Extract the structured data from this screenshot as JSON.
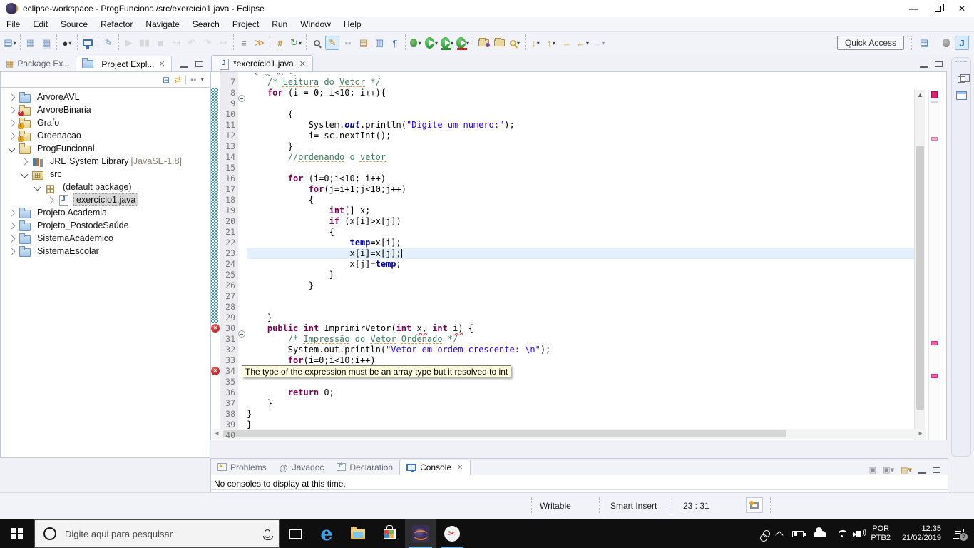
{
  "window": {
    "title": "eclipse-workspace - ProgFuncional/src/exercício1.java - Eclipse",
    "menus": [
      "File",
      "Edit",
      "Source",
      "Refactor",
      "Navigate",
      "Search",
      "Project",
      "Run",
      "Window",
      "Help"
    ]
  },
  "toolbar": {
    "quick_access": "Quick Access",
    "groups": [
      [
        {
          "n": "new-wizard",
          "g": "▤",
          "col": "#4a7ab8",
          "dd": 1
        }
      ],
      [
        {
          "n": "save",
          "g": "▦",
          "col": "#8099bd"
        },
        {
          "n": "save-all",
          "g": "▦",
          "col": "#8099bd",
          "dbl": 1
        }
      ],
      [
        {
          "n": "user-account",
          "g": "●",
          "col": "#2e2e2e",
          "dd": 1
        }
      ],
      [
        {
          "n": "open-console",
          "t": "mon"
        }
      ],
      [
        {
          "n": "block-selection",
          "g": "✎",
          "col": "#7d9bc0"
        }
      ],
      [
        {
          "n": "resume",
          "g": "▶",
          "col": "#c3c3c3",
          "dis": 1
        },
        {
          "n": "suspend",
          "g": "▮▮",
          "col": "#c3c3c3",
          "dis": 1
        },
        {
          "n": "terminate",
          "g": "■",
          "col": "#c3c3c3",
          "dis": 1
        },
        {
          "n": "step-filters",
          "g": "↝",
          "col": "#c3c3c3",
          "dis": 1
        },
        {
          "n": "step-into",
          "g": "↶",
          "col": "#c3c3c3",
          "dis": 1
        },
        {
          "n": "step-over",
          "g": "↷",
          "col": "#c3c3c3",
          "dis": 1
        },
        {
          "n": "step-return",
          "g": "↪",
          "col": "#c3c3c3",
          "dis": 1
        }
      ],
      [
        {
          "n": "skip-all-breakpoints",
          "g": "≡",
          "col": "#8a8a8a"
        },
        {
          "n": "filter",
          "g": "≫",
          "col": "#d08a2a"
        }
      ],
      [
        {
          "n": "new-java-package",
          "g": "#",
          "col": "#c98a2e",
          "bold": 1
        },
        {
          "n": "build-all",
          "g": "↻",
          "col": "#3f9b44",
          "dd": 1
        }
      ],
      [
        {
          "n": "plug-search",
          "t": "mag"
        },
        {
          "n": "mark-occurrences",
          "g": "✎",
          "col": "#c9a23a",
          "act": 1
        },
        {
          "n": "inactive-dots",
          "g": "••",
          "col": "#b0b0b0"
        },
        {
          "n": "open-task",
          "g": "▤",
          "col": "#b58a3a"
        },
        {
          "n": "show-source",
          "g": "▥",
          "col": "#4a7ab8"
        },
        {
          "n": "show-whitespace",
          "g": "¶",
          "col": "#4a7ab8"
        }
      ],
      [
        {
          "n": "debug",
          "t": "bug",
          "dd": 1
        },
        {
          "n": "run",
          "t": "run",
          "dd": 1
        },
        {
          "n": "coverage",
          "t": "runc",
          "dd": 1
        },
        {
          "n": "profile",
          "t": "runp",
          "dd": 1
        }
      ],
      [
        {
          "n": "import-project",
          "t": "foldp"
        },
        {
          "n": "open-project",
          "t": "fold"
        },
        {
          "n": "search-torch",
          "t": "magg",
          "dd": 1
        }
      ],
      [
        {
          "n": "next-annotation",
          "g": "↓",
          "col": "#caa23a",
          "dd": 1
        },
        {
          "n": "prev-annotation",
          "g": "↑",
          "col": "#caa23a",
          "dd": 1
        },
        {
          "n": "last-edit-location",
          "g": "←",
          "col": "#e0a92e"
        },
        {
          "n": "back-history",
          "g": "←",
          "col": "#e0a92e",
          "dd": 1
        },
        {
          "n": "forward-history",
          "g": "→",
          "col": "#c3c3c3",
          "dd": 1,
          "dis": 1
        }
      ]
    ],
    "perspectives": [
      {
        "n": "open-perspective",
        "g": "▤",
        "col": "#4a7ab8"
      },
      {
        "n": "perspective-debug",
        "t": "bugg"
      },
      {
        "n": "perspective-java",
        "g": "J",
        "col": "#2e5fa3",
        "act": 1,
        "bold": 1
      }
    ]
  },
  "explorer": {
    "tab_package": "Package Ex...",
    "tab_project": "Project Expl...",
    "tree": [
      {
        "lvl": 0,
        "chev": "r",
        "icon": "folder",
        "label": "ArvoreAVL"
      },
      {
        "lvl": 0,
        "chev": "r",
        "icon": "jproj",
        "badge": "err",
        "label": "ArvoreBinaria"
      },
      {
        "lvl": 0,
        "chev": "r",
        "icon": "jproj",
        "badge": "warn",
        "label": "Grafo"
      },
      {
        "lvl": 0,
        "chev": "r",
        "icon": "jproj",
        "badge": "warn",
        "label": "Ordenacao"
      },
      {
        "lvl": 0,
        "chev": "d",
        "icon": "jproj",
        "label": "ProgFuncional"
      },
      {
        "lvl": 1,
        "chev": "r",
        "icon": "jre",
        "label": "JRE System Library",
        "suffix": " [JavaSE-1.8]"
      },
      {
        "lvl": 1,
        "chev": "d",
        "icon": "src",
        "label": "src"
      },
      {
        "lvl": 2,
        "chev": "d",
        "icon": "pkg",
        "label": "(default package)"
      },
      {
        "lvl": 3,
        "chev": "r",
        "icon": "jfile",
        "label": "exercício1.java",
        "selected": true
      },
      {
        "lvl": 0,
        "chev": "r",
        "icon": "folder",
        "label": "Projeto Academia"
      },
      {
        "lvl": 0,
        "chev": "r",
        "icon": "folder",
        "label": "Projeto_PostodeSaúde"
      },
      {
        "lvl": 0,
        "chev": "r",
        "icon": "folder",
        "label": "SistemaAcademico"
      },
      {
        "lvl": 0,
        "chev": "r",
        "icon": "folder",
        "label": "SistemaEscolar"
      }
    ]
  },
  "editor": {
    "tab": "*exercício1.java",
    "tooltip": "The type of the expression must be an array type but it resolved to int",
    "range_band": {
      "from": 8,
      "to": 29
    },
    "lines": [
      {
        "n": 7,
        "seg": [
          {
            "t": "    /* ",
            "c": "c"
          },
          {
            "t": "Leitura",
            "c": "c cs"
          },
          {
            "t": " do ",
            "c": "c"
          },
          {
            "t": "Vetor",
            "c": "c cs"
          },
          {
            "t": " */",
            "c": "c"
          }
        ]
      },
      {
        "n": 8,
        "fold": true,
        "seg": [
          {
            "t": "    ",
            "c": "d"
          },
          {
            "t": "for",
            "c": "k"
          },
          {
            "t": " (i = 0; i<10; i++){",
            "c": "d"
          }
        ]
      },
      {
        "n": 9,
        "seg": []
      },
      {
        "n": 10,
        "seg": [
          {
            "t": "        {",
            "c": "d"
          }
        ]
      },
      {
        "n": 11,
        "seg": [
          {
            "t": "            System.",
            "c": "d"
          },
          {
            "t": "out",
            "c": "io"
          },
          {
            "t": ".println(",
            "c": "d"
          },
          {
            "t": "\"Digite um numero:\"",
            "c": "s"
          },
          {
            "t": ");",
            "c": "d"
          }
        ]
      },
      {
        "n": 12,
        "seg": [
          {
            "t": "            i= sc.nextInt();",
            "c": "d"
          }
        ]
      },
      {
        "n": 13,
        "seg": [
          {
            "t": "        }",
            "c": "d"
          }
        ]
      },
      {
        "n": 14,
        "seg": [
          {
            "t": "        //",
            "c": "c"
          },
          {
            "t": "ordenando",
            "c": "c cs"
          },
          {
            "t": " o ",
            "c": "c"
          },
          {
            "t": "vetor",
            "c": "c cs"
          }
        ]
      },
      {
        "n": 15,
        "seg": []
      },
      {
        "n": 16,
        "seg": [
          {
            "t": "        ",
            "c": "d"
          },
          {
            "t": "for",
            "c": "k"
          },
          {
            "t": " (i=0;i<10; i++)",
            "c": "d"
          }
        ]
      },
      {
        "n": 17,
        "seg": [
          {
            "t": "            ",
            "c": "d"
          },
          {
            "t": "for",
            "c": "k"
          },
          {
            "t": "(j=i+1;j<10;j++)",
            "c": "d"
          }
        ]
      },
      {
        "n": 18,
        "seg": [
          {
            "t": "            {",
            "c": "d"
          }
        ]
      },
      {
        "n": 19,
        "seg": [
          {
            "t": "                ",
            "c": "d"
          },
          {
            "t": "int",
            "c": "k"
          },
          {
            "t": "[] x;",
            "c": "d"
          }
        ]
      },
      {
        "n": 20,
        "seg": [
          {
            "t": "                ",
            "c": "d"
          },
          {
            "t": "if",
            "c": "k"
          },
          {
            "t": " (x[i]>x[j])",
            "c": "d"
          }
        ]
      },
      {
        "n": 21,
        "seg": [
          {
            "t": "                {",
            "c": "d"
          }
        ]
      },
      {
        "n": 22,
        "seg": [
          {
            "t": "                    ",
            "c": "d"
          },
          {
            "t": "temp",
            "c": "f"
          },
          {
            "t": "=x[i];",
            "c": "d"
          }
        ]
      },
      {
        "n": 23,
        "current": true,
        "caret": true,
        "seg": [
          {
            "t": "                    x[i]=x[j];",
            "c": "d"
          }
        ]
      },
      {
        "n": 24,
        "seg": [
          {
            "t": "                    x[j]=",
            "c": "d"
          },
          {
            "t": "temp",
            "c": "f"
          },
          {
            "t": ";",
            "c": "d"
          }
        ]
      },
      {
        "n": 25,
        "seg": [
          {
            "t": "                }",
            "c": "d"
          }
        ]
      },
      {
        "n": 26,
        "seg": [
          {
            "t": "            }",
            "c": "d"
          }
        ]
      },
      {
        "n": 27,
        "seg": []
      },
      {
        "n": 28,
        "seg": []
      },
      {
        "n": 29,
        "seg": [
          {
            "t": "    }",
            "c": "d"
          }
        ]
      },
      {
        "n": 30,
        "fold": true,
        "error": true,
        "seg": [
          {
            "t": "    ",
            "c": "d"
          },
          {
            "t": "public",
            "c": "k"
          },
          {
            "t": " ",
            "c": "d"
          },
          {
            "t": "int",
            "c": "k"
          },
          {
            "t": " ImprimirVetor(",
            "c": "d"
          },
          {
            "t": "int",
            "c": "k"
          },
          {
            "t": " ",
            "c": "d"
          },
          {
            "t": "x,",
            "c": "d es"
          },
          {
            "t": " ",
            "c": "d"
          },
          {
            "t": "int",
            "c": "k"
          },
          {
            "t": " ",
            "c": "d"
          },
          {
            "t": "i)",
            "c": "d es"
          },
          {
            "t": " {",
            "c": "d"
          }
        ]
      },
      {
        "n": 31,
        "seg": [
          {
            "t": "        /* ",
            "c": "c"
          },
          {
            "t": "Impressão",
            "c": "c cs"
          },
          {
            "t": " do ",
            "c": "c"
          },
          {
            "t": "Vetor",
            "c": "c cs"
          },
          {
            "t": " ",
            "c": "c"
          },
          {
            "t": "Ordenado",
            "c": "c cs"
          },
          {
            "t": " */",
            "c": "c"
          }
        ]
      },
      {
        "n": 32,
        "seg": [
          {
            "t": "        System.out.println(",
            "c": "d"
          },
          {
            "t": "\"Vetor em ordem crescente: \\n\"",
            "c": "s"
          },
          {
            "t": ");",
            "c": "d"
          }
        ]
      },
      {
        "n": 33,
        "seg": [
          {
            "t": "        ",
            "c": "d"
          },
          {
            "t": "for",
            "c": "k"
          },
          {
            "t": "(i=0;i<10;i++)",
            "c": "d"
          }
        ]
      },
      {
        "n": 34,
        "error": true,
        "seg": []
      },
      {
        "n": 35,
        "seg": []
      },
      {
        "n": 36,
        "seg": [
          {
            "t": "        ",
            "c": "d"
          },
          {
            "t": "return",
            "c": "k"
          },
          {
            "t": " 0;",
            "c": "d"
          }
        ]
      },
      {
        "n": 37,
        "seg": [
          {
            "t": "    }",
            "c": "d"
          }
        ]
      },
      {
        "n": 38,
        "seg": [
          {
            "t": "}",
            "c": "d"
          }
        ]
      },
      {
        "n": 39,
        "seg": [
          {
            "t": "}",
            "c": "d"
          }
        ]
      },
      {
        "n": 40,
        "seg": []
      }
    ]
  },
  "console": {
    "tabs": [
      {
        "label": "Problems",
        "icon": "problems"
      },
      {
        "label": "Javadoc",
        "icon": "javadoc"
      },
      {
        "label": "Declaration",
        "icon": "decl"
      },
      {
        "label": "Console",
        "icon": "console",
        "active": true
      }
    ],
    "message": "No consoles to display at this time."
  },
  "status": {
    "writable": "Writable",
    "insert_mode": "Smart Insert",
    "position": "23 : 31"
  },
  "taskbar": {
    "search_placeholder": "Digite aqui para pesquisar",
    "lang_top": "POR",
    "lang_bottom": "PTB2",
    "time": "12:35",
    "date": "21/02/2019",
    "notification_count": "2"
  }
}
